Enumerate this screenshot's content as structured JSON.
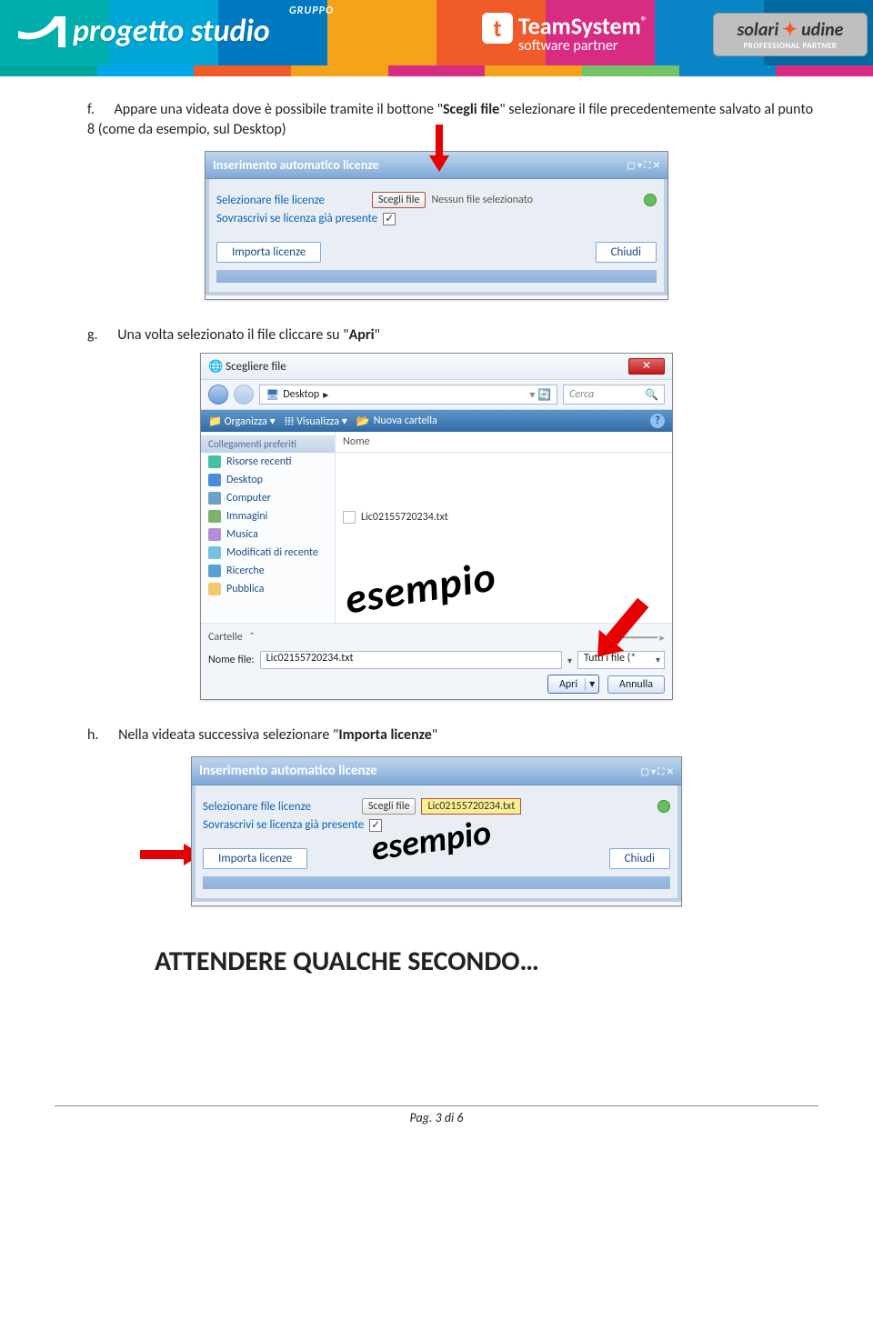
{
  "header": {
    "gruppo": "GRUPPO",
    "brand": "progetto studio",
    "ts_line1": "TeamSystem",
    "ts_line2": "software partner",
    "solari_name": "solari",
    "solari_city": "udine",
    "solari_sub": "PROFESSIONAL PARTNER"
  },
  "text": {
    "f_marker": "f.",
    "f_body_1": "Appare una videata dove è possibile tramite il bottone \"",
    "f_body_bold": "Scegli file",
    "f_body_2": "\" selezionare il file precedentemente salvato al punto 8 (come da esempio, sul Desktop)",
    "g_marker": "g.",
    "g_body_1": "Una volta selezionato il file cliccare su \"",
    "g_body_bold": "Apri",
    "g_body_2": "\"",
    "h_marker": "h.",
    "h_body_1": "Nella videata successiva selezionare \"",
    "h_body_bold": "Importa licenze",
    "h_body_2": "\"",
    "wait": "ATTENDERE QUALCHE SECONDO…"
  },
  "panel1": {
    "title": "Inserimento automatico licenze",
    "label_select": "Selezionare file licenze",
    "btn_scegli": "Scegli file",
    "no_file": "Nessun file selezionato",
    "label_overwrite": "Sovrascrivi se licenza già presente",
    "btn_import": "Importa licenze",
    "btn_close": "Chiudi"
  },
  "dialog": {
    "title": "Scegliere file",
    "bread_root": "Desktop",
    "search_placeholder": "Cerca",
    "tb_org": "Organizza",
    "tb_views": "Visualizza",
    "tb_newfolder": "Nuova cartella",
    "side_header": "Collegamenti preferiti",
    "side_items": [
      "Risorse recenti",
      "Desktop",
      "Computer",
      "Immagini",
      "Musica",
      "Modificati di recente",
      "Ricerche",
      "Pubblica"
    ],
    "col_name": "Nome",
    "file_name": "Lic02155720234.txt",
    "cartelle": "Cartelle",
    "label_nomefile": "Nome file:",
    "filter": "Tutti i file (*",
    "btn_apri": "Apri",
    "btn_annulla": "Annulla",
    "esempio": "esempio"
  },
  "panel3": {
    "selected_file": "Lic02155720234.txt",
    "esempio": "esempio"
  },
  "footer": {
    "page": "Pag. 3 di 6"
  }
}
